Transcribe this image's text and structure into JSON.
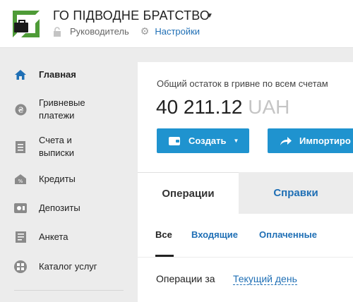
{
  "header": {
    "org_title": "ГО ПІДВОДНЕ БРАТСТВО",
    "role": "Руководитель",
    "settings_label": "Настройки",
    "brand_color": "#4e9b37",
    "accent_color": "#1f6fb5"
  },
  "sidebar": {
    "items": [
      {
        "label": "Главная",
        "icon": "home-icon",
        "active": true
      },
      {
        "label": "Гривневые платежи",
        "icon": "hryvnia-icon"
      },
      {
        "label": "Счета и выписки",
        "icon": "document-icon"
      },
      {
        "label": "Кредиты",
        "icon": "credit-house-icon"
      },
      {
        "label": "Депозиты",
        "icon": "deposit-icon"
      },
      {
        "label": "Анкета",
        "icon": "form-icon"
      },
      {
        "label": "Каталог услуг",
        "icon": "catalog-icon"
      }
    ]
  },
  "main": {
    "balance_label": "Общий остаток в гривне по всем счетам",
    "balance_amount": "40 211.12",
    "balance_currency": "UAH",
    "create_button": "Создать",
    "import_button": "Импортиро",
    "button_color": "#1f93cf"
  },
  "tabs": [
    {
      "label": "Операции",
      "active": true
    },
    {
      "label": "Справки"
    }
  ],
  "filters": [
    {
      "label": "Все",
      "active": true
    },
    {
      "label": "Входящие"
    },
    {
      "label": "Оплаченные"
    }
  ],
  "period": {
    "label": "Операции за",
    "value": "Текущий день"
  }
}
